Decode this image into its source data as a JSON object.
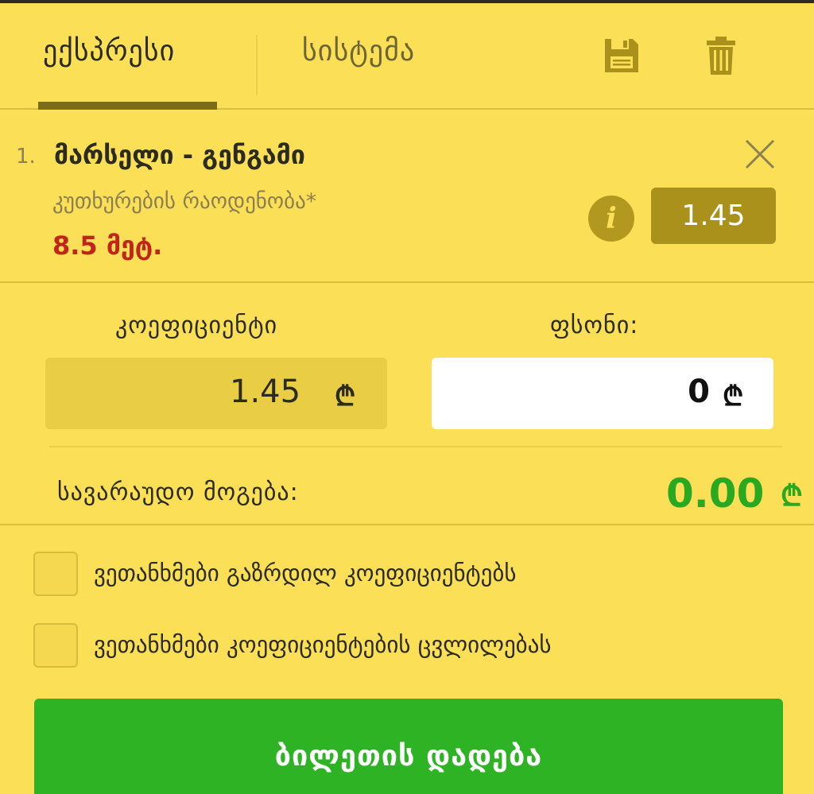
{
  "tabs": {
    "express_label": "ექსპრესი",
    "system_label": "სისტემა",
    "save_icon": "save-icon",
    "trash_icon": "trash-icon"
  },
  "event": {
    "number": "1.",
    "teams": "მარსელი - გენგამი",
    "market": "კუთხურების რაოდენობა*",
    "outcome": "8.5 მეტ.",
    "odd": "1.45",
    "info_symbol": "i"
  },
  "inputs": {
    "coefficient_label": "კოეფიციენტი",
    "coefficient_value": "1.45",
    "stake_label": "ფსონი:",
    "stake_value": "0",
    "currency": "₾"
  },
  "win": {
    "label": "სავარაუდო მოგება:",
    "value": "0.00",
    "currency": "₾"
  },
  "checks": [
    {
      "label": "ვეთანხმები გაზრდილ კოეფიციენტებს",
      "checked": false
    },
    {
      "label": "ვეთანხმები კოეფიციენტების ცვლილებას",
      "checked": false
    }
  ],
  "place_bet_label": "ბილეთის დადება",
  "colors": {
    "background": "#FBDF56",
    "accent_dark": "#a9911c",
    "win_green": "#2aa820",
    "button_green": "#2db324",
    "outcome_red": "#c0241a"
  }
}
